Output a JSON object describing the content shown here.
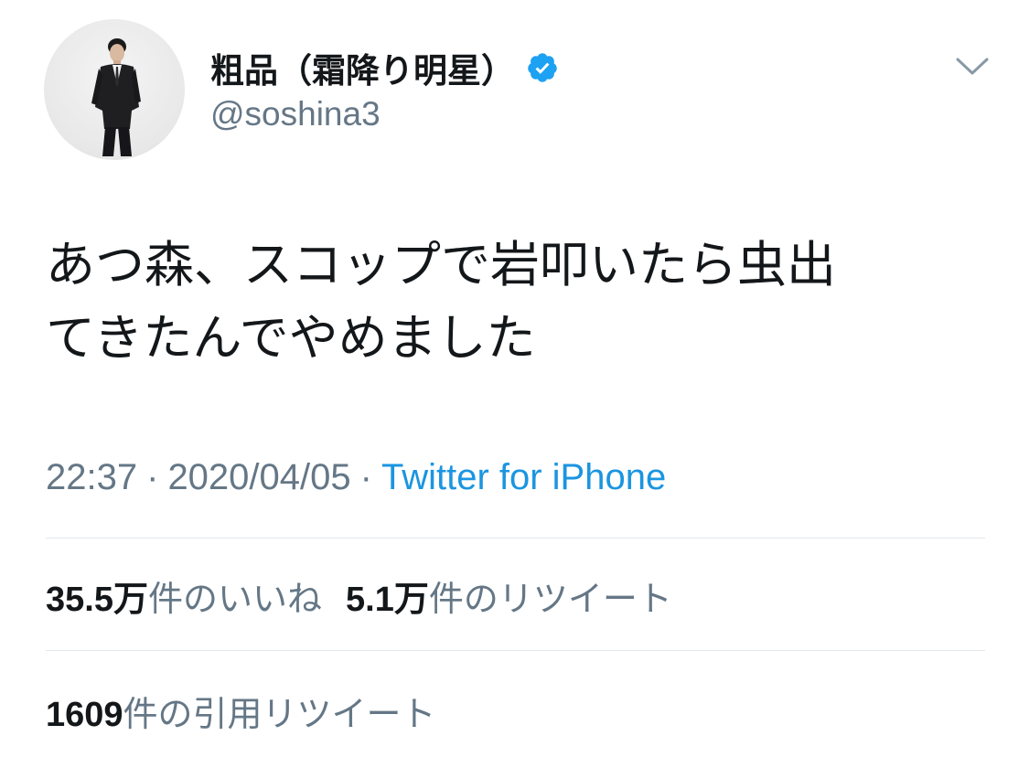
{
  "tweet": {
    "author": {
      "display_name": "粗品（霜降り明星）",
      "handle": "@soshina3",
      "verified": true
    },
    "text": "あつ森、スコップで岩叩いたら虫出\nてきたんでやめました",
    "time": "22:37",
    "date": "2020/04/05",
    "separator": "·",
    "source": "Twitter for iPhone",
    "stats": {
      "likes_number": "35.5",
      "likes_unit": "万",
      "likes_label": "件のいいね",
      "retweets_number": "5.1",
      "retweets_unit": "万",
      "retweets_label": "件のリツイート",
      "quotes_number": "1609",
      "quotes_label": "件の引用リツイート"
    }
  },
  "icons": {
    "verified_badge": "verified-badge-icon",
    "menu": "chevron-down-icon"
  },
  "colors": {
    "text_primary": "#14171a",
    "text_secondary": "#657786",
    "link": "#1b95e0",
    "verified": "#1da1f2",
    "divider": "#e1e8ed"
  }
}
